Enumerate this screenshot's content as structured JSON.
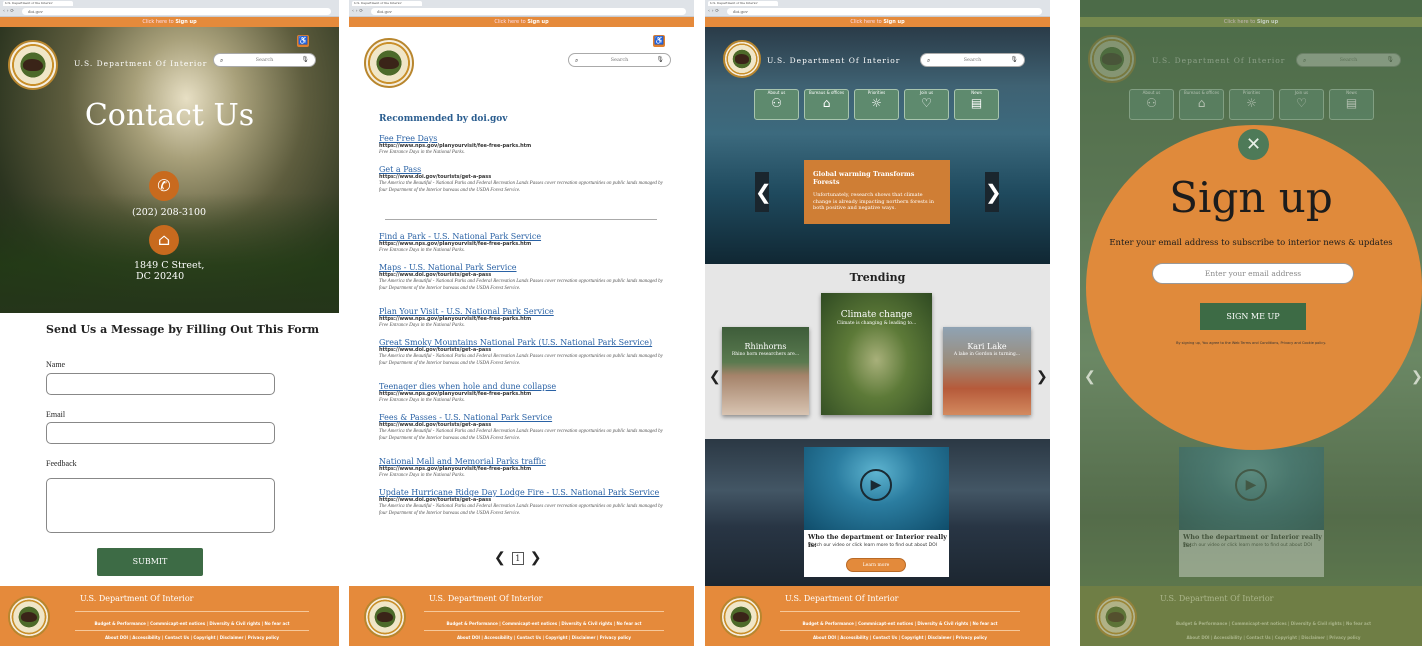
{
  "browser": {
    "tab_title": "U.S. Department of the Interior",
    "url": "doi.gov"
  },
  "header": {
    "signup_prompt": "Click here to",
    "signup_link": "Sign up",
    "site_name": "U.S. Department Of Interior",
    "search_placeholder": "Search"
  },
  "contact": {
    "title": "Contact Us",
    "phone": "(202) 208-3100",
    "address_line1": "1849 C Street,",
    "address_line2": "DC 20240",
    "form_title": "Send Us a Message by Filling Out This Form",
    "name_label": "Name",
    "email_label": "Email",
    "feedback_label": "Feedback",
    "submit_label": "SUBMIT"
  },
  "search_results": {
    "recommended_title": "Recommended by doi.gov",
    "recommended": [
      {
        "title": "Fee Free Days",
        "url": "https://www.nps.gov/planyourvisit/fee-free-parks.htm",
        "desc": "Free Entrance Days in the National Parks."
      },
      {
        "title": "Get a Pass",
        "url": "https://www.doi.gov/tourists/get-a-pass",
        "desc": "The America the Beautiful - National Parks and Federal Recreation Lands Passes cover recreation opportunities on public lands managed by four Department of the Interior bureaus and the USDA Forest Service."
      }
    ],
    "results": [
      {
        "title": "Find a Park - U.S. National Park Service",
        "url": "https://www.nps.gov/planyourvisit/fee-free-parks.htm",
        "desc": "Free Entrance Days in the National Parks."
      },
      {
        "title": "Maps - U.S. National Park Service",
        "url": "https://www.doi.gov/tourists/get-a-pass",
        "desc": "The America the Beautiful - National Parks and Federal Recreation Lands Passes cover recreation opportunities on public lands managed by four Department of the Interior bureaus and the USDA Forest Service."
      },
      {
        "title": "Plan Your Visit - U.S. National Park Service",
        "url": "https://www.nps.gov/planyourvisit/fee-free-parks.htm",
        "desc": "Free Entrance Days in the National Parks."
      },
      {
        "title": "Great Smoky Mountains National Park (U.S. National Park Service)",
        "url": "https://www.doi.gov/tourists/get-a-pass",
        "desc": "The America the Beautiful - National Parks and Federal Recreation Lands Passes cover recreation opportunities on public lands managed by four Department of the Interior bureaus and the USDA Forest Service."
      },
      {
        "title": "Teenager dies when hole and dune collapse",
        "url": "https://www.nps.gov/planyourvisit/fee-free-parks.htm",
        "desc": "Free Entrance Days in the National Parks."
      },
      {
        "title": "Fees & Passes - U.S. National Park Service",
        "url": "https://www.doi.gov/tourists/get-a-pass",
        "desc": "The America the Beautiful - National Parks and Federal Recreation Lands Passes cover recreation opportunities on public lands managed by four Department of the Interior bureaus and the USDA Forest Service."
      },
      {
        "title": "National Mall and Memorial Parks traffic",
        "url": "https://www.nps.gov/planyourvisit/fee-free-parks.htm",
        "desc": "Free Entrance Days in the National Parks."
      },
      {
        "title": "Update Hurricane Ridge Day Lodge Fire - U.S. National Park Service",
        "url": "https://www.doi.gov/tourists/get-a-pass",
        "desc": "The America the Beautiful - National Parks and Federal Recreation Lands Passes cover recreation opportunities on public lands managed by four Department of the Interior bureaus and the USDA Forest Service."
      }
    ],
    "current_page": "1"
  },
  "home": {
    "nav_tiles": [
      "About us",
      "Bureaus & offices",
      "Priorities",
      "Join us",
      "News"
    ],
    "hero_card_title": "Global warming Transforms Forests",
    "hero_card_desc": "Unfortunately, research shows that climate change is already impacting northern forests in both positive and negative ways.",
    "trending_title": "Trending",
    "trending": [
      {
        "title": "Rhinhorns",
        "sub": "Rhino horn researchers are..."
      },
      {
        "title": "Climate change",
        "sub": "Climate is changing & leading to..."
      },
      {
        "title": "Kari Lake",
        "sub": "A lake in Gordon is turning..."
      }
    ],
    "video_title": "Who the department or Interior really is:",
    "video_sub": "Watch our video or click learn more to find out about DOI",
    "video_button": "Learn more"
  },
  "signup_modal": {
    "title": "Sign up",
    "subtitle": "Enter your email address to subscribe to interior news & updates",
    "email_placeholder": "Enter your email address",
    "button": "SIGN ME UP",
    "fine_print": "By signing up, You agree to the Web Terms and Conditions, Privacy and Cookie policy."
  },
  "footer": {
    "title": "U.S. Department Of Interior",
    "links_row1": "Budget & Performance | Commnicapt-ent notices | Diversity & Civil rights | No fear act",
    "links_row2": "About DOI | Accessibility | Contact Us | Copyright | Disclaimer | Privacy policy"
  },
  "colors": {
    "accent_orange": "#e58a3b",
    "primary_green": "#3d6b45",
    "link_blue": "#2a62a5"
  },
  "icons": {
    "phone": "phone-icon",
    "home": "home-icon",
    "search": "search-icon",
    "mic": "mic-icon",
    "accessibility": "accessibility-icon",
    "play": "play-icon",
    "close": "close-icon"
  }
}
